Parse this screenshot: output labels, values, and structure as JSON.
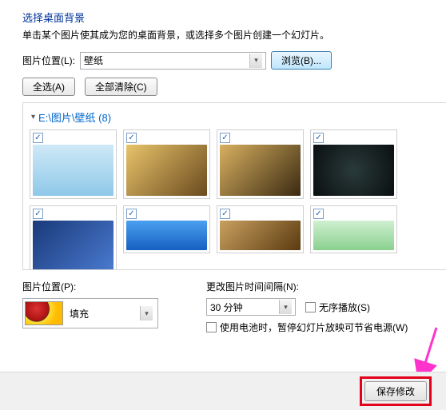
{
  "header": {
    "title": "选择桌面背景",
    "subtitle": "单击某个图片使其成为您的桌面背景，或选择多个图片创建一个幻灯片。"
  },
  "location": {
    "label": "图片位置(L):",
    "value": "壁纸",
    "browse": "浏览(B)..."
  },
  "buttons": {
    "select_all": "全选(A)",
    "clear_all": "全部清除(C)"
  },
  "folder": {
    "path": "E:\\图片\\壁纸",
    "count": "(8)"
  },
  "fit": {
    "label": "图片位置(P):",
    "value": "填充"
  },
  "interval": {
    "label": "更改图片时间间隔(N):",
    "value": "30 分钟",
    "shuffle": "无序播放(S)",
    "battery": "使用电池时，暂停幻灯片放映可节省电源(W)"
  },
  "footer": {
    "save": "保存修改"
  },
  "thumbs": [
    {
      "bg": "linear-gradient(#cfe9f7,#8fc8e8)"
    },
    {
      "bg": "linear-gradient(135deg,#e8c46a,#6b4a1f)"
    },
    {
      "bg": "linear-gradient(135deg,#d8b060,#3a2a12)"
    },
    {
      "bg": "radial-gradient(circle,#2a3a3a,#0a0f10)"
    },
    {
      "bg": "linear-gradient(135deg,#1a3a7a,#4a7ad0)"
    },
    {
      "bg": "linear-gradient(#4aa0f0,#1560c0)"
    },
    {
      "bg": "linear-gradient(135deg,#c8a060,#5a3a10)"
    },
    {
      "bg": "linear-gradient(#cff0d0,#8ad090)"
    }
  ]
}
